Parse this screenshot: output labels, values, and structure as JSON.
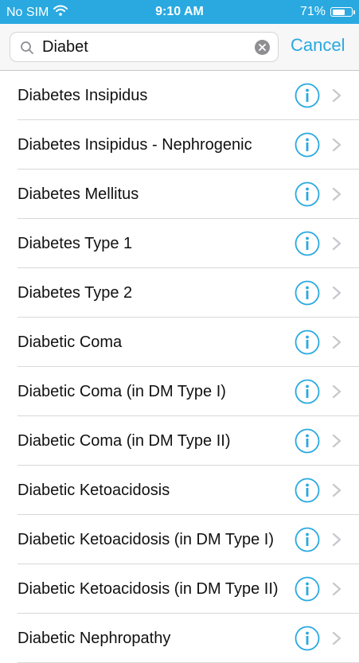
{
  "status_bar": {
    "carrier": "No SIM",
    "time": "9:10 AM",
    "battery_percent": "71%",
    "battery_level": 0.71
  },
  "search": {
    "value": "Diabet",
    "cancel_label": "Cancel"
  },
  "colors": {
    "accent": "#29a9e0",
    "status_bar_bg": "#29a9e0",
    "chevron": "#c7c7cc"
  },
  "icons": {
    "search": "magnifier-icon",
    "clear": "clear-x-icon",
    "info": "info-circle-icon",
    "chevron": "chevron-right-icon",
    "wifi": "wifi-icon",
    "battery": "battery-icon"
  },
  "results": [
    {
      "label": "Diabetes Insipidus"
    },
    {
      "label": "Diabetes Insipidus - Nephrogenic"
    },
    {
      "label": "Diabetes Mellitus"
    },
    {
      "label": "Diabetes Type 1"
    },
    {
      "label": "Diabetes Type 2"
    },
    {
      "label": "Diabetic Coma"
    },
    {
      "label": "Diabetic Coma (in DM Type I)"
    },
    {
      "label": "Diabetic Coma (in DM Type II)"
    },
    {
      "label": "Diabetic Ketoacidosis"
    },
    {
      "label": "Diabetic Ketoacidosis (in DM Type I)"
    },
    {
      "label": "Diabetic Ketoacidosis (in DM Type II)"
    },
    {
      "label": "Diabetic Nephropathy"
    }
  ]
}
